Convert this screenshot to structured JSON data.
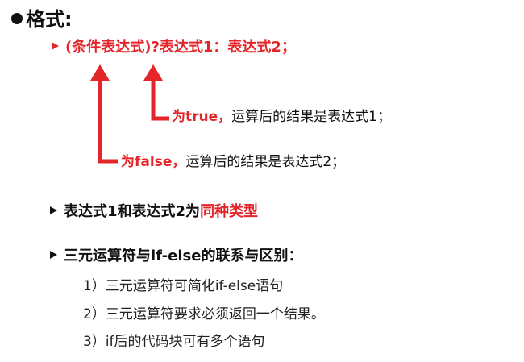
{
  "heading": "格式:",
  "syntax": "(条件表达式)?表达式1：表达式2；",
  "notes": {
    "true_keyword": "为true，",
    "true_text": "运算后的结果是表达式1；",
    "false_keyword": "为false，",
    "false_text": "运算后的结果是表达式2；"
  },
  "bullets": {
    "same_type_prefix": "表达式1和表达式2为",
    "same_type_highlight": "同种类型",
    "relation": "三元运算符与if-else的联系与区别："
  },
  "sub_items": [
    "1）三元运算符可简化if-else语句",
    "2）三元运算符要求必须返回一个结果。",
    "3）if后的代码块可有多个语句"
  ],
  "colors": {
    "accent": "#e4262a",
    "text": "#111111"
  }
}
